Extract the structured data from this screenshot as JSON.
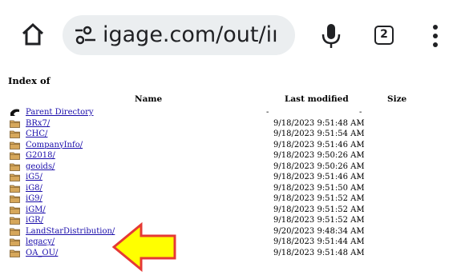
{
  "browser": {
    "url": "igage.com/out/iı",
    "tab_count": "2",
    "icons": {
      "home": "home-icon",
      "site_settings": "tune-icon",
      "mic": "mic-icon",
      "menu": "more-vert-icon"
    }
  },
  "page": {
    "title": "Index of",
    "headers": {
      "name": "Name",
      "last_modified": "Last modified",
      "size": "Size"
    },
    "parent": {
      "name": "Parent Directory",
      "date": "-",
      "size": "-"
    },
    "entries": [
      {
        "name": "BRx7/",
        "date": "9/18/2023 9:51:48 AM",
        "size": "-"
      },
      {
        "name": "CHC/",
        "date": "9/18/2023 9:51:54 AM",
        "size": "-"
      },
      {
        "name": "CompanyInfo/",
        "date": "9/18/2023 9:51:46 AM",
        "size": "-"
      },
      {
        "name": "G2018/",
        "date": "9/18/2023 9:50:26 AM",
        "size": "-"
      },
      {
        "name": "geoids/",
        "date": "9/18/2023 9:50:26 AM",
        "size": "-"
      },
      {
        "name": "iG5/",
        "date": "9/18/2023 9:51:46 AM",
        "size": "-"
      },
      {
        "name": "iG8/",
        "date": "9/18/2023 9:51:50 AM",
        "size": "-"
      },
      {
        "name": "iG9/",
        "date": "9/18/2023 9:51:52 AM",
        "size": "-"
      },
      {
        "name": "iGM/",
        "date": "9/18/2023 9:51:52 AM",
        "size": "-"
      },
      {
        "name": "iGR/",
        "date": "9/18/2023 9:51:52 AM",
        "size": "-"
      },
      {
        "name": "LandStarDistribution/",
        "date": "9/20/2023 9:48:34 AM",
        "size": "-"
      },
      {
        "name": "legacy/",
        "date": "9/18/2023 9:51:44 AM",
        "size": "-"
      },
      {
        "name": "OA_OU/",
        "date": "9/18/2023 9:51:48 AM",
        "size": "-"
      }
    ]
  },
  "colors": {
    "link": "#1a0dab",
    "folder": "#d6a75b",
    "arrow_fill": "#ffff00",
    "arrow_stroke": "#e53935",
    "url_bar": "#ebeef0"
  }
}
